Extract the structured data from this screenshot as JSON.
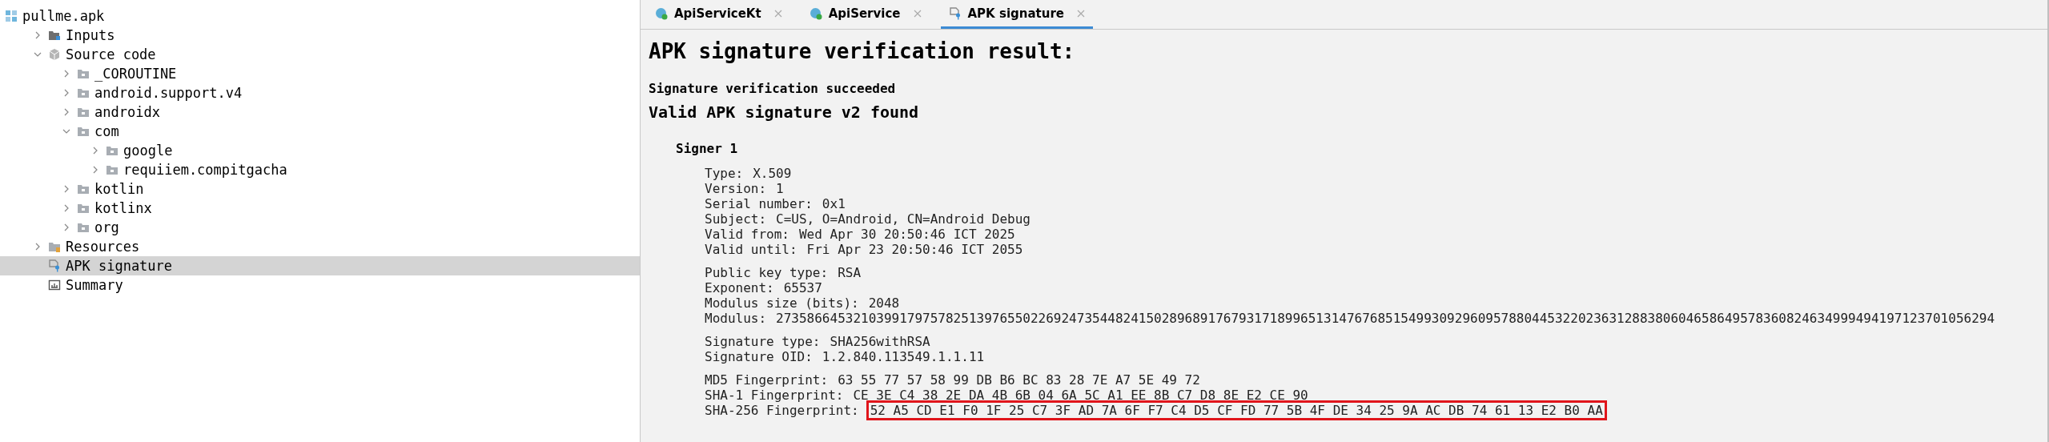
{
  "tree": [
    {
      "label": "pullme.apk",
      "kind": "project",
      "expanded": true,
      "selected": false,
      "children": [
        {
          "label": "Inputs",
          "kind": "inputs",
          "expanded": false,
          "selected": false
        },
        {
          "label": "Source code",
          "kind": "source",
          "expanded": true,
          "selected": false,
          "children": [
            {
              "label": "_COROUTINE",
              "kind": "package",
              "expanded": false,
              "selected": false
            },
            {
              "label": "android.support.v4",
              "kind": "package",
              "expanded": false,
              "selected": false
            },
            {
              "label": "androidx",
              "kind": "package",
              "expanded": false,
              "selected": false
            },
            {
              "label": "com",
              "kind": "package",
              "expanded": true,
              "selected": false,
              "children": [
                {
                  "label": "google",
                  "kind": "package",
                  "expanded": false,
                  "selected": false
                },
                {
                  "label": "requiiem.compitgacha",
                  "kind": "package",
                  "expanded": false,
                  "selected": false
                }
              ]
            },
            {
              "label": "kotlin",
              "kind": "package",
              "expanded": false,
              "selected": false
            },
            {
              "label": "kotlinx",
              "kind": "package",
              "expanded": false,
              "selected": false
            },
            {
              "label": "org",
              "kind": "package",
              "expanded": false,
              "selected": false
            }
          ]
        },
        {
          "label": "Resources",
          "kind": "resources",
          "expanded": false,
          "selected": false
        },
        {
          "label": "APK signature",
          "kind": "signature",
          "selected": true
        },
        {
          "label": "Summary",
          "kind": "summary",
          "selected": false
        }
      ]
    }
  ],
  "tabs": [
    {
      "label": "ApiServiceKt",
      "kind": "class",
      "selected": false
    },
    {
      "label": "ApiService",
      "kind": "class",
      "selected": false
    },
    {
      "label": "APK signature",
      "kind": "signature",
      "selected": true
    }
  ],
  "report": {
    "title": "APK signature verification result:",
    "status": "Signature verification succeeded",
    "found": "Valid APK signature v2 found",
    "signer": "Signer 1",
    "groups": [
      [
        {
          "label": "Type:",
          "value": "X.509",
          "highlighted": false
        },
        {
          "label": "Version:",
          "value": "1",
          "highlighted": false
        },
        {
          "label": "Serial number:",
          "value": "0x1",
          "highlighted": false
        },
        {
          "label": "Subject:",
          "value": "C=US, O=Android, CN=Android Debug",
          "highlighted": false
        },
        {
          "label": "Valid from:",
          "value": "Wed Apr 30 20:50:46 ICT 2025",
          "highlighted": false
        },
        {
          "label": "Valid until:",
          "value": "Fri Apr 23 20:50:46 ICT 2055",
          "highlighted": false
        }
      ],
      [
        {
          "label": "Public key type:",
          "value": "RSA",
          "highlighted": false
        },
        {
          "label": "Exponent:",
          "value": "65537",
          "highlighted": false
        },
        {
          "label": "Modulus size (bits):",
          "value": "2048",
          "highlighted": false
        },
        {
          "label": "Modulus:",
          "value": "27358664532103991797578251397655022692473544824150289689176793171899651314767685154993092960957880445322023631288380604658649578360824634999494197123701056294",
          "highlighted": false
        }
      ],
      [
        {
          "label": "Signature type:",
          "value": "SHA256withRSA",
          "highlighted": false
        },
        {
          "label": "Signature OID:",
          "value": "1.2.840.113549.1.1.11",
          "highlighted": false
        }
      ],
      [
        {
          "label": "MD5 Fingerprint:",
          "value": "63 55 77 57 58 99 DB B6 BC 83 28 7E A7 5E 49 72",
          "highlighted": false
        },
        {
          "label": "SHA-1 Fingerprint:",
          "value": "CE 3E C4 38 2E DA 4B 6B 04 6A 5C A1 EE 8B C7 D8 8E E2 CE 90",
          "highlighted": false
        },
        {
          "label": "SHA-256 Fingerprint:",
          "value": "52 A5 CD E1 F0 1F 25 C7 3F AD 7A 6F F7 C4 D5 CF FD 77 5B 4F DE 34 25 9A AC DB 74 61 13 E2 B0 AA",
          "highlighted": true
        }
      ]
    ]
  }
}
